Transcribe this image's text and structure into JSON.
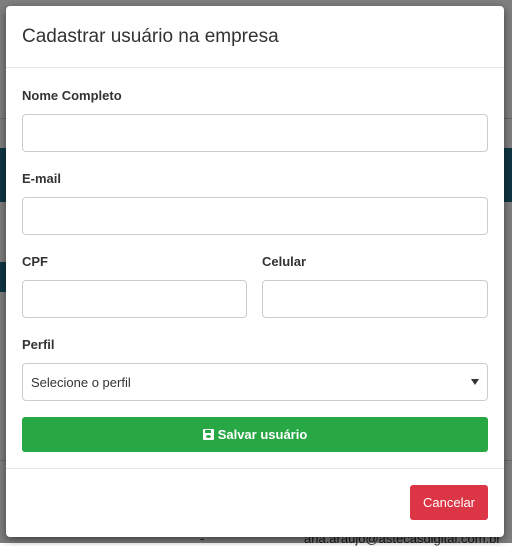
{
  "modal": {
    "title": "Cadastrar usuário na empresa",
    "fields": {
      "nome_label": "Nome Completo",
      "nome_value": "",
      "email_label": "E-mail",
      "email_value": "",
      "cpf_label": "CPF",
      "cpf_value": "",
      "celular_label": "Celular",
      "celular_value": "",
      "perfil_label": "Perfil",
      "perfil_selected": "Selecione o perfil"
    },
    "save_label": "Salvar usuário",
    "cancel_label": "Cancelar"
  },
  "background": {
    "partial_email": "ana.araujo@astecasdigital.com.br",
    "partial_dash": "-"
  },
  "colors": {
    "save": "#28a745",
    "cancel": "#dc3545",
    "background_band": "#1f6f86"
  },
  "icons": {
    "save": "floppy-disk-icon",
    "select_caret": "caret-down-icon"
  }
}
